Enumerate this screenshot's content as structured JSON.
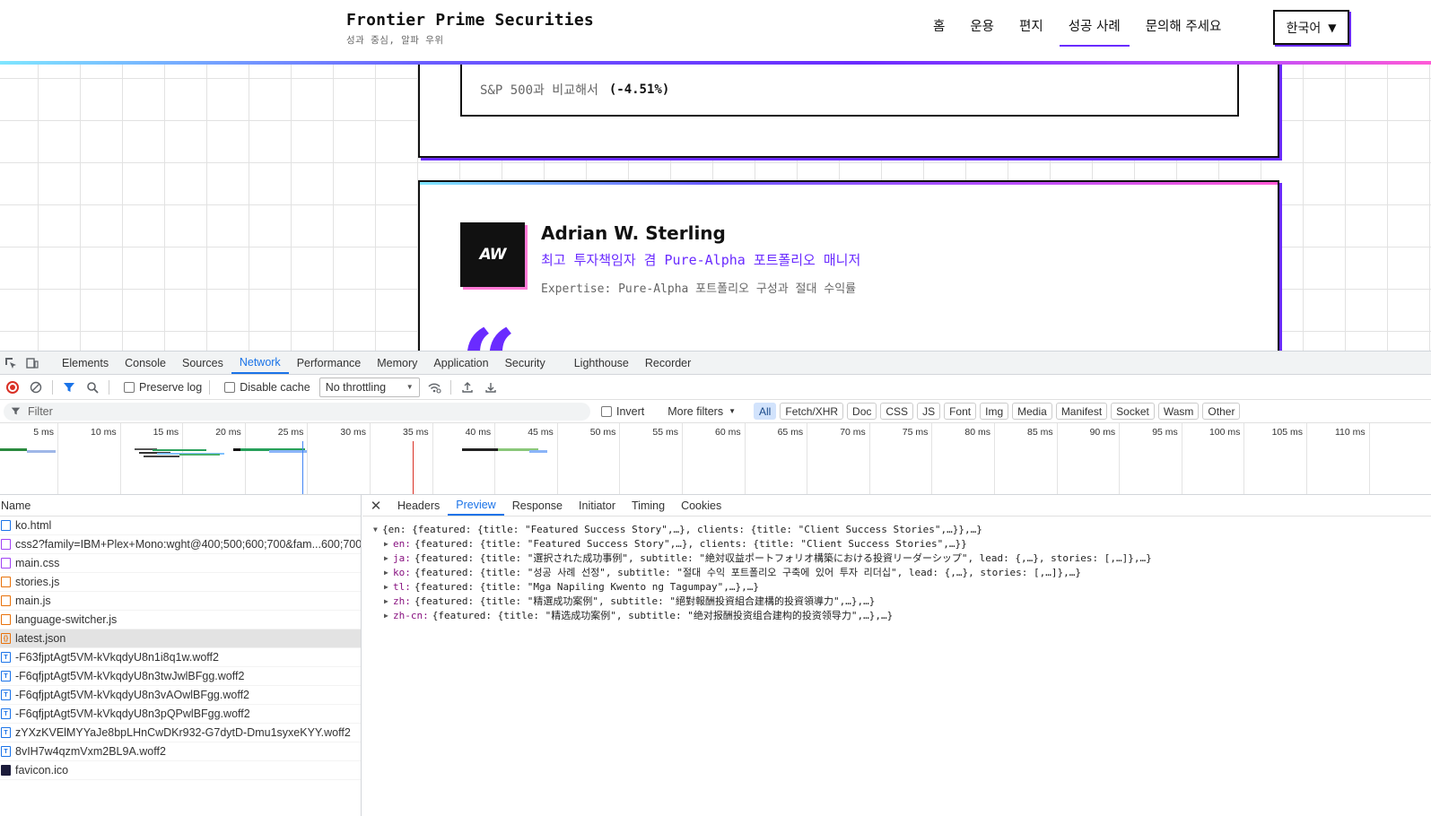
{
  "site": {
    "brand_name": "Frontier Prime Securities",
    "brand_tagline": "성과 중심, 알파 우위",
    "nav": [
      "홈",
      "운용",
      "편지",
      "성공 사례",
      "문의해 주세요"
    ],
    "nav_active": "성공 사례",
    "language": "한국어",
    "comparison_label": "S&P 500과 비교해서",
    "comparison_value": "(-4.51%)",
    "person": {
      "initials": "AW",
      "name": "Adrian W. Sterling",
      "role": "최고 투자책임자 겸 Pure-Alpha 포트폴리오 매니저",
      "expertise": "Expertise: Pure-Alpha 포트폴리오 구성과 절대 수익률"
    },
    "quote_mark": "“"
  },
  "devtools": {
    "tabs": [
      "Elements",
      "Console",
      "Sources",
      "Network",
      "Performance",
      "Memory",
      "Application",
      "Security",
      "Lighthouse",
      "Recorder"
    ],
    "active_tab": "Network",
    "preserve_log": "Preserve log",
    "disable_cache": "Disable cache",
    "throttling": "No throttling",
    "filter_placeholder": "Filter",
    "invert": "Invert",
    "more_filters": "More filters",
    "chips": [
      "All",
      "Fetch/XHR",
      "Doc",
      "CSS",
      "JS",
      "Font",
      "Img",
      "Media",
      "Manifest",
      "Socket",
      "Wasm",
      "Other"
    ],
    "active_chip": "All",
    "timeline_ticks": [
      "5 ms",
      "10 ms",
      "15 ms",
      "20 ms",
      "25 ms",
      "30 ms",
      "35 ms",
      "40 ms",
      "45 ms",
      "50 ms",
      "55 ms",
      "60 ms",
      "65 ms",
      "70 ms",
      "75 ms",
      "80 ms",
      "85 ms",
      "90 ms",
      "95 ms",
      "100 ms",
      "105 ms",
      "110 ms"
    ],
    "name_header": "Name",
    "requests": [
      {
        "name": "ko.html",
        "type": "doc"
      },
      {
        "name": "css2?family=IBM+Plex+Mono:wght@400;500;600;700&fam...600;700...",
        "type": "css"
      },
      {
        "name": "main.css",
        "type": "css"
      },
      {
        "name": "stories.js",
        "type": "js"
      },
      {
        "name": "main.js",
        "type": "js"
      },
      {
        "name": "language-switcher.js",
        "type": "js"
      },
      {
        "name": "latest.json",
        "type": "json"
      },
      {
        "name": "-F63fjptAgt5VM-kVkqdyU8n1i8q1w.woff2",
        "type": "font"
      },
      {
        "name": "-F6qfjptAgt5VM-kVkqdyU8n3twJwlBFgg.woff2",
        "type": "font"
      },
      {
        "name": "-F6qfjptAgt5VM-kVkqdyU8n3vAOwlBFgg.woff2",
        "type": "font"
      },
      {
        "name": "-F6qfjptAgt5VM-kVkqdyU8n3pQPwlBFgg.woff2",
        "type": "font"
      },
      {
        "name": "zYXzKVElMYYaJe8bpLHnCwDKr932-G7dytD-Dmu1syxeKYY.woff2",
        "type": "font"
      },
      {
        "name": "8vIH7w4qzmVxm2BL9A.woff2",
        "type": "font"
      },
      {
        "name": "favicon.ico",
        "type": "ico"
      }
    ],
    "selected_request": "latest.json",
    "detail_tabs": [
      "Headers",
      "Preview",
      "Response",
      "Initiator",
      "Timing",
      "Cookies"
    ],
    "active_detail_tab": "Preview",
    "preview_root": "{en: {featured: {title: \"Featured Success Story\",…}, clients: {title: \"Client Success Stories\",…}},…}",
    "preview_children": [
      {
        "key": "en:",
        "value": "{featured: {title: \"Featured Success Story\",…}, clients: {title: \"Client Success Stories\",…}}"
      },
      {
        "key": "ja:",
        "value": "{featured: {title: \"選択された成功事例\", subtitle: \"絶対収益ポートフォリオ構築における投資リーダーシップ\", lead: {,…}, stories: [,…]},…}"
      },
      {
        "key": "ko:",
        "value": "{featured: {title: \"성공 사례 선정\", subtitle: \"절대 수익 포트폴리오 구축에 있어 투자 리더십\", lead: {,…}, stories: [,…]},…}"
      },
      {
        "key": "tl:",
        "value": "{featured: {title: \"Mga Napiling Kwento ng Tagumpay\",…},…}"
      },
      {
        "key": "zh:",
        "value": "{featured: {title: \"精選成功案例\", subtitle: \"絕對報酬投資組合建構的投資領導力\",…},…}"
      },
      {
        "key": "zh-cn:",
        "value": "{featured: {title: \"精选成功案例\", subtitle: \"绝对报酬投资组合建构的投资领导力\",…},…}"
      }
    ]
  }
}
